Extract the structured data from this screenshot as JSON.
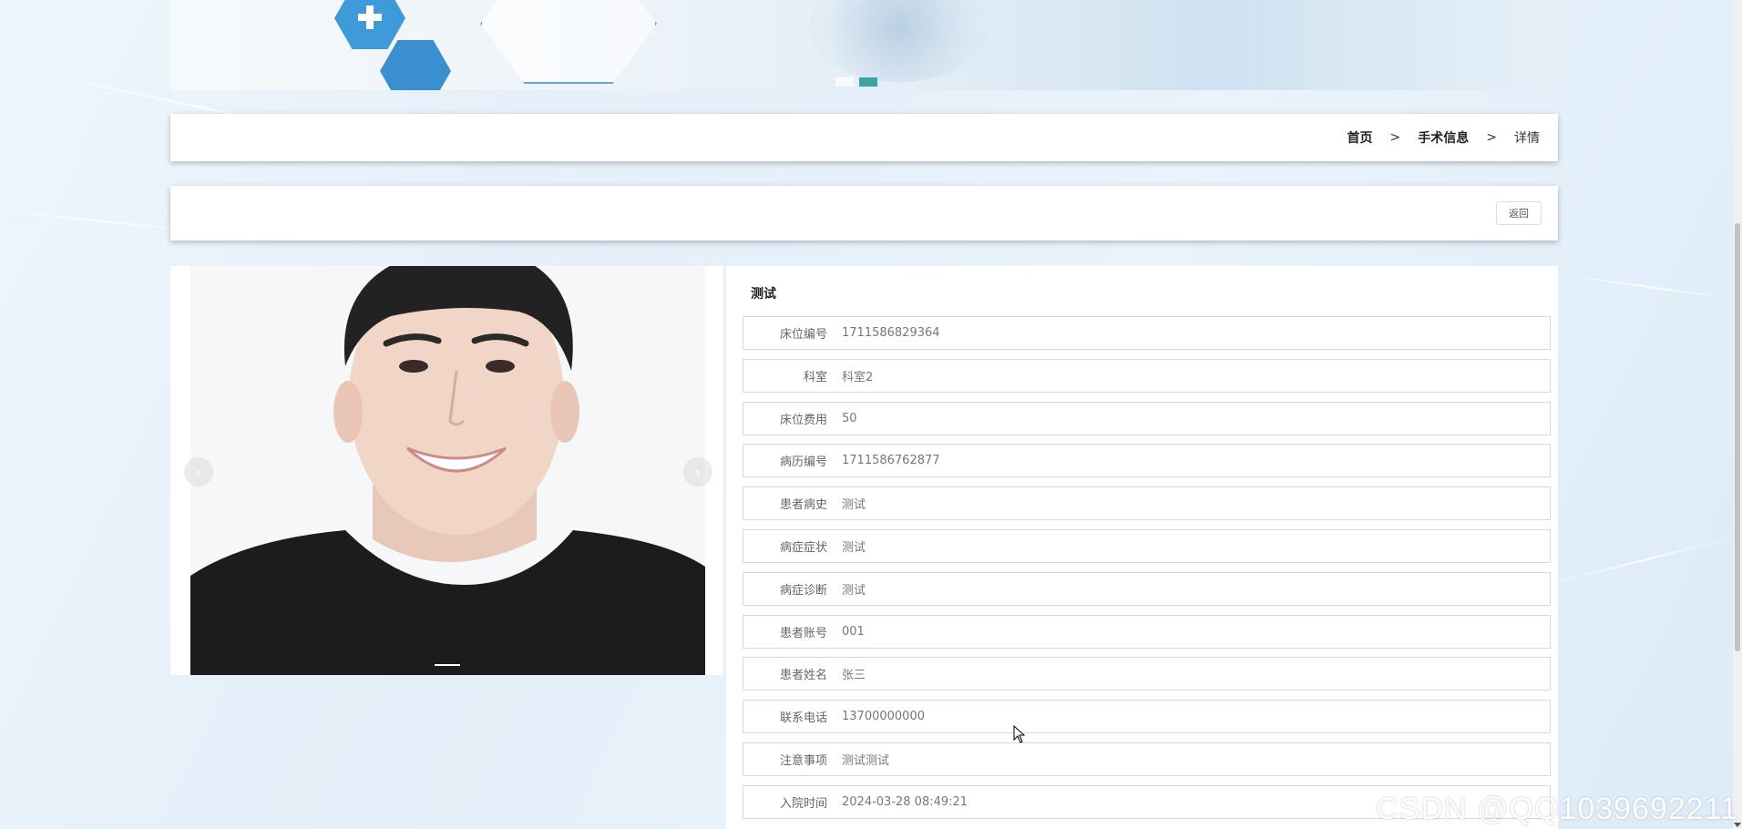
{
  "breadcrumb": {
    "home": "首页",
    "section": "手术信息",
    "current": "详情",
    "separator": ">"
  },
  "actions": {
    "back_label": "返回"
  },
  "carousel": {
    "prev_icon": "chevron-left-icon",
    "next_icon": "chevron-right-icon"
  },
  "detail": {
    "title": "测试",
    "fields": [
      {
        "label": "床位编号",
        "value": "1711586829364"
      },
      {
        "label": "科室",
        "value": "科室2"
      },
      {
        "label": "床位费用",
        "value": "50"
      },
      {
        "label": "病历编号",
        "value": "1711586762877"
      },
      {
        "label": "患者病史",
        "value": "测试"
      },
      {
        "label": "病症症状",
        "value": "测试"
      },
      {
        "label": "病症诊断",
        "value": "测试"
      },
      {
        "label": "患者账号",
        "value": "001"
      },
      {
        "label": "患者姓名",
        "value": "张三"
      },
      {
        "label": "联系电话",
        "value": "13700000000"
      },
      {
        "label": "注意事项",
        "value": "测试测试"
      },
      {
        "label": "入院时间",
        "value": "2024-03-28 08:49:21"
      }
    ]
  },
  "watermark": "CSDN @QQ1039692211",
  "colors": {
    "accent_teal": "#3ba3a3",
    "banner_blue": "#3e9ad8"
  }
}
